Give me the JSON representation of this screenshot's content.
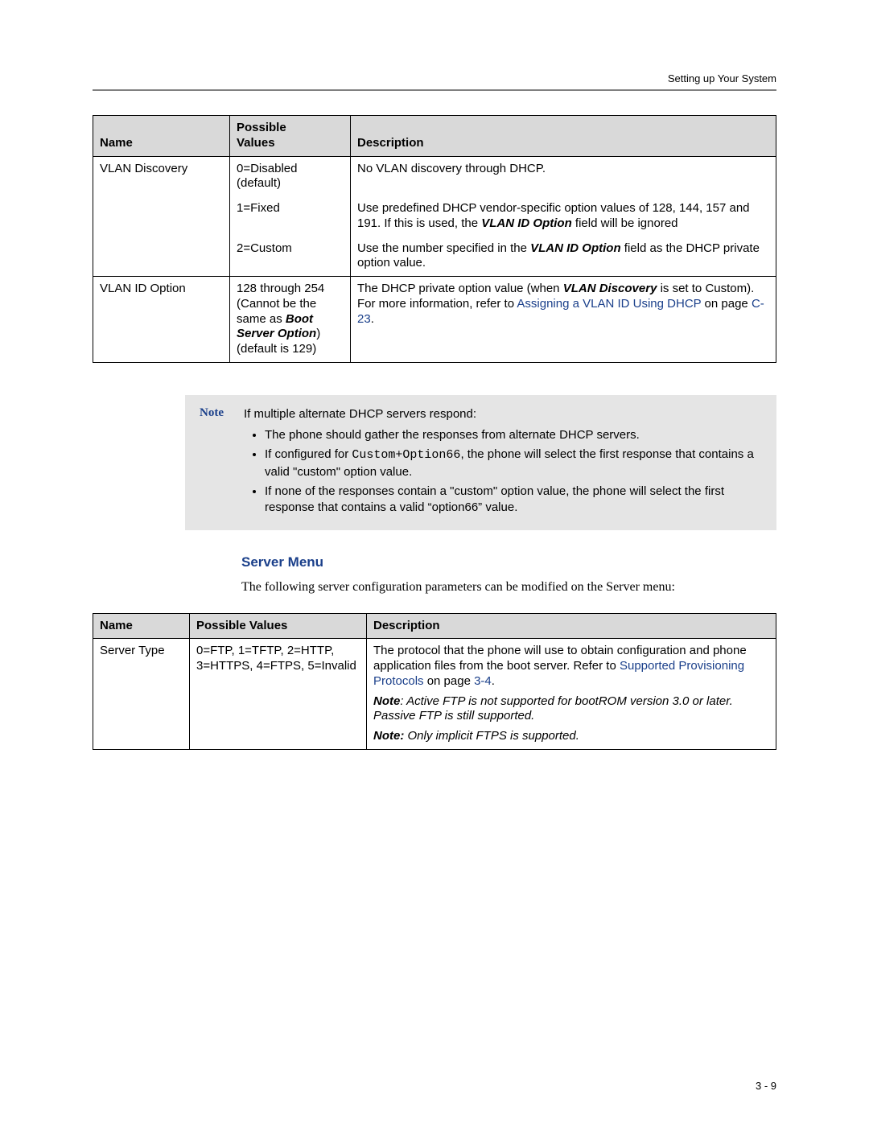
{
  "header": {
    "running_head": "Setting up Your System"
  },
  "table1": {
    "headers": {
      "name": "Name",
      "values": "Possible\nValues",
      "desc": "Description"
    },
    "rows": [
      {
        "name": "VLAN Discovery",
        "subrows": [
          {
            "value": "0=Disabled (default)",
            "desc_parts": [
              {
                "t": "plain",
                "v": "No VLAN discovery through DHCP."
              }
            ]
          },
          {
            "value": "1=Fixed",
            "desc_parts": [
              {
                "t": "plain",
                "v": "Use predefined DHCP vendor-specific option values of 128, 144, 157 and 191. If this is used, the "
              },
              {
                "t": "bi",
                "v": "VLAN ID Option"
              },
              {
                "t": "plain",
                "v": " field will be ignored"
              }
            ]
          },
          {
            "value": "2=Custom",
            "desc_parts": [
              {
                "t": "plain",
                "v": "Use the number specified in the "
              },
              {
                "t": "bi",
                "v": "VLAN ID Option"
              },
              {
                "t": "plain",
                "v": " field as the DHCP private option value."
              }
            ]
          }
        ]
      },
      {
        "name": "VLAN ID Option",
        "subrows": [
          {
            "value_parts": [
              {
                "t": "plain",
                "v": "128 through 254 (Cannot be the same as "
              },
              {
                "t": "bi",
                "v": "Boot Server Option"
              },
              {
                "t": "plain",
                "v": ")"
              },
              {
                "t": "br"
              },
              {
                "t": "plain",
                "v": "(default is 129)"
              }
            ],
            "desc_parts": [
              {
                "t": "plain",
                "v": "The DHCP private option value (when "
              },
              {
                "t": "bi",
                "v": "VLAN Discovery"
              },
              {
                "t": "plain",
                "v": " is set to Custom)."
              },
              {
                "t": "br"
              },
              {
                "t": "plain",
                "v": "For more information, refer to "
              },
              {
                "t": "link",
                "v": "Assigning a VLAN ID Using DHCP"
              },
              {
                "t": "plain",
                "v": " on page "
              },
              {
                "t": "link",
                "v": "C-23"
              },
              {
                "t": "plain",
                "v": "."
              }
            ]
          }
        ]
      }
    ]
  },
  "note": {
    "label": "Note",
    "intro": "If multiple alternate DHCP servers respond:",
    "bullets": [
      [
        {
          "t": "plain",
          "v": "The phone should gather the responses from alternate DHCP servers."
        }
      ],
      [
        {
          "t": "plain",
          "v": "If configured for "
        },
        {
          "t": "mono",
          "v": "Custom+Option66"
        },
        {
          "t": "plain",
          "v": ", the phone will select the first response that contains a valid \"custom\" option value."
        }
      ],
      [
        {
          "t": "plain",
          "v": "If none of the responses contain a \"custom\" option value, the phone will select the first response that contains a valid “option66” value."
        }
      ]
    ]
  },
  "section": {
    "heading": "Server Menu",
    "intro": "The following server configuration parameters can be modified on the Server menu:"
  },
  "table2": {
    "headers": {
      "name": "Name",
      "values": "Possible Values",
      "desc": "Description"
    },
    "rows": [
      {
        "name": "Server Type",
        "value": "0=FTP, 1=TFTP, 2=HTTP, 3=HTTPS, 4=FTPS, 5=Invalid",
        "desc_parts": [
          {
            "t": "plain",
            "v": "The protocol that the phone will use to obtain configuration and phone application files from the boot server. Refer to "
          },
          {
            "t": "link",
            "v": "Supported Provisioning Protocols"
          },
          {
            "t": "plain",
            "v": " on page "
          },
          {
            "t": "link",
            "v": "3-4"
          },
          {
            "t": "plain",
            "v": "."
          },
          {
            "t": "br"
          },
          {
            "t": "gap"
          },
          {
            "t": "bi",
            "v": "Note"
          },
          {
            "t": "i",
            "v": ": Active FTP is not supported for bootROM version 3.0 or later. Passive FTP is still supported."
          },
          {
            "t": "br"
          },
          {
            "t": "gap"
          },
          {
            "t": "bi",
            "v": "Note:"
          },
          {
            "t": "i",
            "v": " Only implicit FTPS is supported."
          }
        ]
      }
    ]
  },
  "page_number": "3 - 9"
}
